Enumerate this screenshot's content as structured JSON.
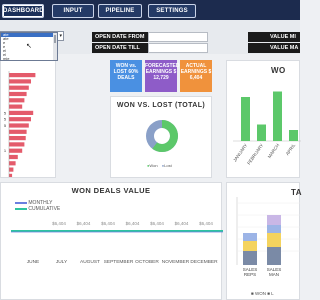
{
  "nav": {
    "tabs": [
      {
        "label": "DASHBOARD"
      },
      {
        "label": "INPUT"
      },
      {
        "label": "PIPELINE"
      },
      {
        "label": "SETTINGS"
      }
    ]
  },
  "filters": {
    "open_date_from": "OPEN DATE FROM",
    "open_date_till": "OPEN DATE TILL",
    "value_min": "VALUE MI",
    "value_max": "VALUE MA"
  },
  "dropdown": {
    "items": [
      "ate",
      "ate",
      "e",
      "e",
      "el",
      "el",
      "mie",
      "e",
      "e"
    ],
    "selected_index": 0
  },
  "kpis": [
    {
      "text": "WON vs. LOST 60% DEALS",
      "color": "#4a90e2"
    },
    {
      "text": "FORECASTED EARNINGS $ 12,729",
      "color": "#8e5cc8"
    },
    {
      "text": "ACTUAL EARNINGS $ 6,404",
      "color": "#f0923c"
    }
  ],
  "won_vs_lost": {
    "title": "WON VS. LOST (TOTAL)",
    "legend": [
      "Won",
      "Lost"
    ],
    "won_fraction": 0.6,
    "colors": {
      "won": "#5cc86a",
      "lost": "#8aa0c8"
    }
  },
  "left_bars": {
    "labels": [
      "",
      "",
      "",
      "",
      "",
      "",
      "5",
      "5",
      "5",
      "",
      "",
      "",
      "1",
      "",
      "",
      "",
      ""
    ],
    "values": [
      0.6,
      0.5,
      0.45,
      0.4,
      0.35,
      0.3,
      0.55,
      0.5,
      0.45,
      0.4,
      0.38,
      0.35,
      0.3,
      0.2,
      0.15,
      0.1,
      0.07
    ],
    "color": "#e45b6b"
  },
  "won_right": {
    "title": "WO",
    "categories": [
      "JANUARY",
      "FEBRUARY",
      "MARCH",
      "APRIL"
    ],
    "values": [
      0.8,
      0.3,
      0.9,
      0.2
    ],
    "color": "#5cc86a"
  },
  "won_deals_value": {
    "title": "WON DEALS VALUE",
    "legend": [
      "MONTHLY",
      "CUMULATIVE"
    ],
    "legend_colors": [
      "#6b7fe0",
      "#2ec4a0"
    ],
    "months": [
      "JUNE",
      "JULY",
      "AUGUST",
      "SEPTEMBER",
      "OCTOBER",
      "NOVEMBER",
      "DECEMBER"
    ],
    "labels": [
      "6,404",
      "6,404",
      "6,404",
      "6,404",
      "6,404",
      "6,404",
      "6,404",
      "6,404"
    ]
  },
  "ta_panel": {
    "title": "TA",
    "categories": [
      "SALES REPS",
      "SALES MAN"
    ],
    "legend": [
      "WON",
      "L"
    ],
    "stack_colors": [
      "#7a8aa6",
      "#f4d35e",
      "#9cb4e6",
      "#c9b7e6"
    ]
  }
}
